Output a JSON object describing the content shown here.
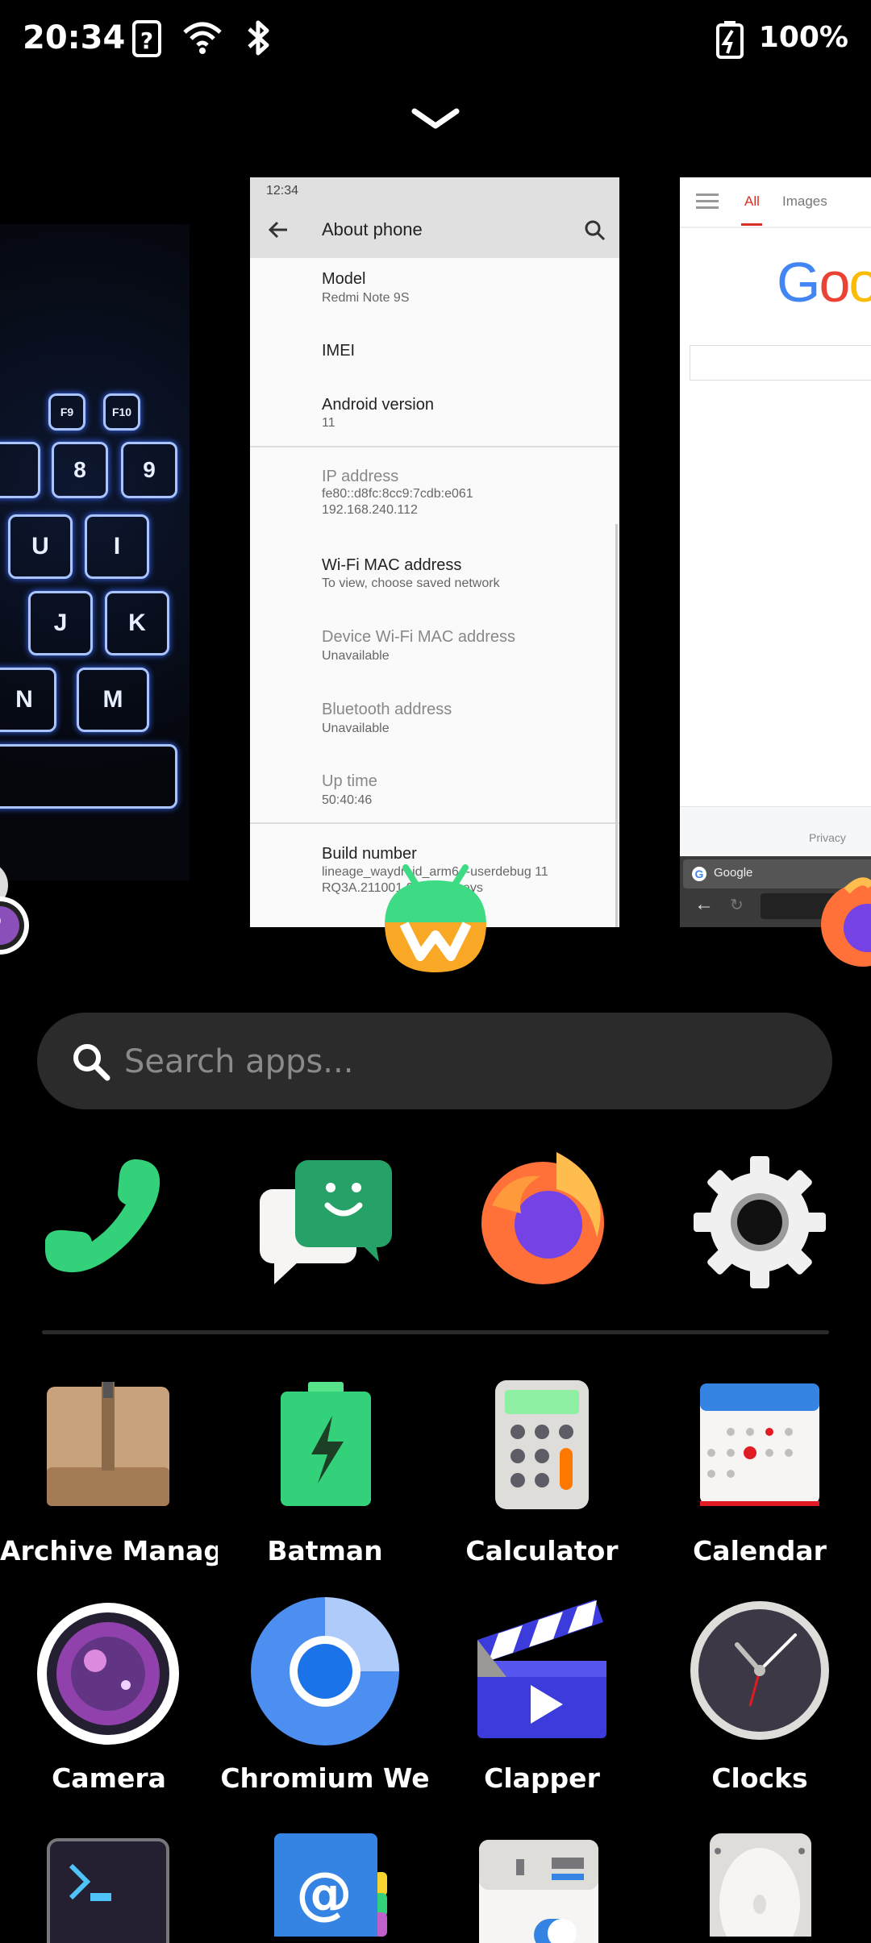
{
  "status_bar": {
    "time": "20:34",
    "battery": "100%",
    "icons": [
      "unknown-sim-icon",
      "wifi-icon",
      "bluetooth-icon",
      "battery-charging-icon"
    ]
  },
  "overview": {
    "collapse_icon": "chevron-down-icon"
  },
  "recent_apps": {
    "keyboard_photo": {
      "keys": [
        "F9",
        "F10",
        "*",
        "8",
        "(",
        "9",
        "U",
        "I",
        "J",
        "K",
        "N",
        "M"
      ]
    },
    "about_phone": {
      "status_time": "12:34",
      "title": "About phone",
      "rows": [
        {
          "title": "Model",
          "value": "Redmi Note 9S"
        },
        {
          "title": "IMEI",
          "value": ""
        },
        {
          "title": "Android version",
          "value": "11"
        },
        {
          "title": "IP address",
          "value": "fe80::d8fc:8cc9:7cdb:e061",
          "value2": "192.168.240.112"
        },
        {
          "title": "Wi-Fi MAC address",
          "value": "To view, choose saved network"
        },
        {
          "title": "Device Wi-Fi MAC address",
          "value": "Unavailable"
        },
        {
          "title": "Bluetooth address",
          "value": "Unavailable"
        },
        {
          "title": "Up time",
          "value": "50:40:46"
        },
        {
          "title": "Build number",
          "value": "lineage_waydroid_arm64-userdebug 11",
          "value2": "RQ3A.211001.001 test-keys"
        }
      ]
    },
    "browser": {
      "tabs": [
        "All",
        "Images"
      ],
      "logo": "Google",
      "footer": "Privacy",
      "tab_title": "Google"
    }
  },
  "search": {
    "placeholder": "Search apps..."
  },
  "favorites": [
    "Phone",
    "Chats",
    "Firefox",
    "Settings"
  ],
  "apps": [
    {
      "label": "Archive Manag"
    },
    {
      "label": "Batman"
    },
    {
      "label": "Calculator"
    },
    {
      "label": "Calendar"
    },
    {
      "label": "Camera"
    },
    {
      "label": "Chromium We"
    },
    {
      "label": "Clapper"
    },
    {
      "label": "Clocks"
    },
    {
      "label": ""
    },
    {
      "label": ""
    },
    {
      "label": ""
    },
    {
      "label": ""
    }
  ],
  "colors": {
    "accent_red": "#d93025",
    "search_bg": "#2b2b2b"
  }
}
